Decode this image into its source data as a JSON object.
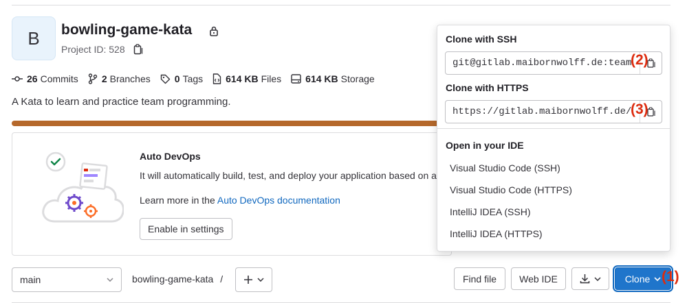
{
  "project": {
    "avatar_letter": "B",
    "title": "bowling-game-kata",
    "id_label": "Project ID: 528",
    "description": "A Kata to learn and practice team programming.",
    "language_bar_color": "#b5682b"
  },
  "stats": {
    "commits_count": "26",
    "commits_label": "Commits",
    "branches_count": "2",
    "branches_label": "Branches",
    "tags_count": "0",
    "tags_label": "Tags",
    "files_size": "614 KB",
    "files_label": "Files",
    "storage_size": "614 KB",
    "storage_label": "Storage"
  },
  "devops": {
    "title": "Auto DevOps",
    "text": "It will automatically build, test, and deploy your application based on a predefined CI/CD configuration.",
    "learn_prefix": "Learn more in the ",
    "learn_link": "Auto DevOps documentation",
    "enable_button": "Enable in settings"
  },
  "toolbar": {
    "branch": "main",
    "breadcrumb": "bowling-game-kata",
    "breadcrumb_sep": "/",
    "find_file": "Find file",
    "web_ide": "Web IDE",
    "clone": "Clone",
    "accent_color": "#1f75cb"
  },
  "clone_dropdown": {
    "ssh_heading": "Clone with SSH",
    "ssh_url": "git@gitlab.maibornwolff.de:team",
    "https_heading": "Clone with HTTPS",
    "https_url": "https://gitlab.maibornwolff.de/",
    "ide_heading": "Open in your IDE",
    "ide_items": [
      "Visual Studio Code (SSH)",
      "Visual Studio Code (HTTPS)",
      "IntelliJ IDEA (SSH)",
      "IntelliJ IDEA (HTTPS)"
    ]
  },
  "markers": {
    "one": "(1)",
    "two": "(2)",
    "three": "(3)",
    "color": "#dd2b0e"
  },
  "icons": [
    "lock-icon",
    "copy-icon",
    "commit-icon",
    "branch-icon",
    "tag-icon",
    "file-icon",
    "storage-icon",
    "chevron-down-icon",
    "plus-icon",
    "download-icon"
  ]
}
